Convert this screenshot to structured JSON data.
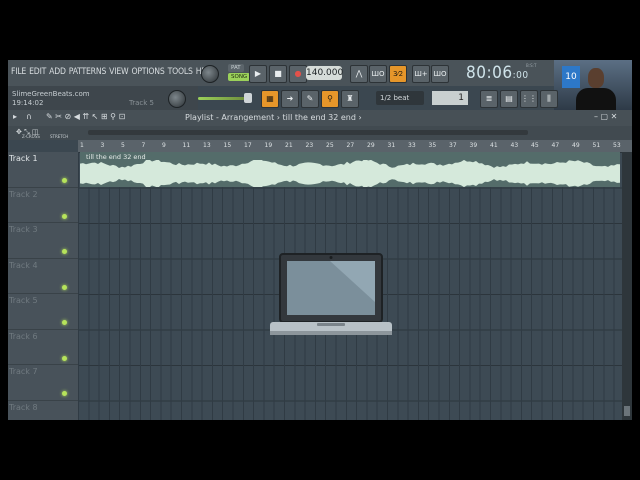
{
  "menu": [
    "FILE",
    "EDIT",
    "ADD",
    "PATTERNS",
    "VIEW",
    "OPTIONS",
    "TOOLS",
    "HELP"
  ],
  "hint": {
    "site": "SlimeGreenBeats.com",
    "time": "19:14:02",
    "track": "Track 5"
  },
  "transport": {
    "pat": "PAT",
    "song": "SONG",
    "tempo": "140.000",
    "clock_main": "80:06",
    "clock_small": ":00",
    "bst": "B:S:T"
  },
  "toolbar": {
    "snap": "1/2 beat",
    "step_value": "1",
    "btn_32": "3⁄2"
  },
  "webcam": {
    "jersey": "10"
  },
  "playlist": {
    "breadcrumb": "Playlist - Arrangement › till the end 32 end ›"
  },
  "tools": {
    "label1": "Z-CROSS",
    "label2": "STRETCH"
  },
  "ruler_ticks": [
    "1",
    "3",
    "5",
    "7",
    "9",
    "11",
    "13",
    "15",
    "17",
    "19",
    "21",
    "23",
    "25",
    "27",
    "29",
    "31",
    "33",
    "35",
    "37",
    "39",
    "41",
    "43",
    "45",
    "47",
    "49",
    "51",
    "53"
  ],
  "tracks": [
    "Track 1",
    "Track 2",
    "Track 3",
    "Track 4",
    "Track 5",
    "Track 6",
    "Track 7",
    "Track 8"
  ],
  "clip": {
    "name": "till the end 32 end"
  },
  "colors": {
    "accent": "#e6962a",
    "clip_wave": "#d5e9db",
    "led": "#b6e35b"
  }
}
